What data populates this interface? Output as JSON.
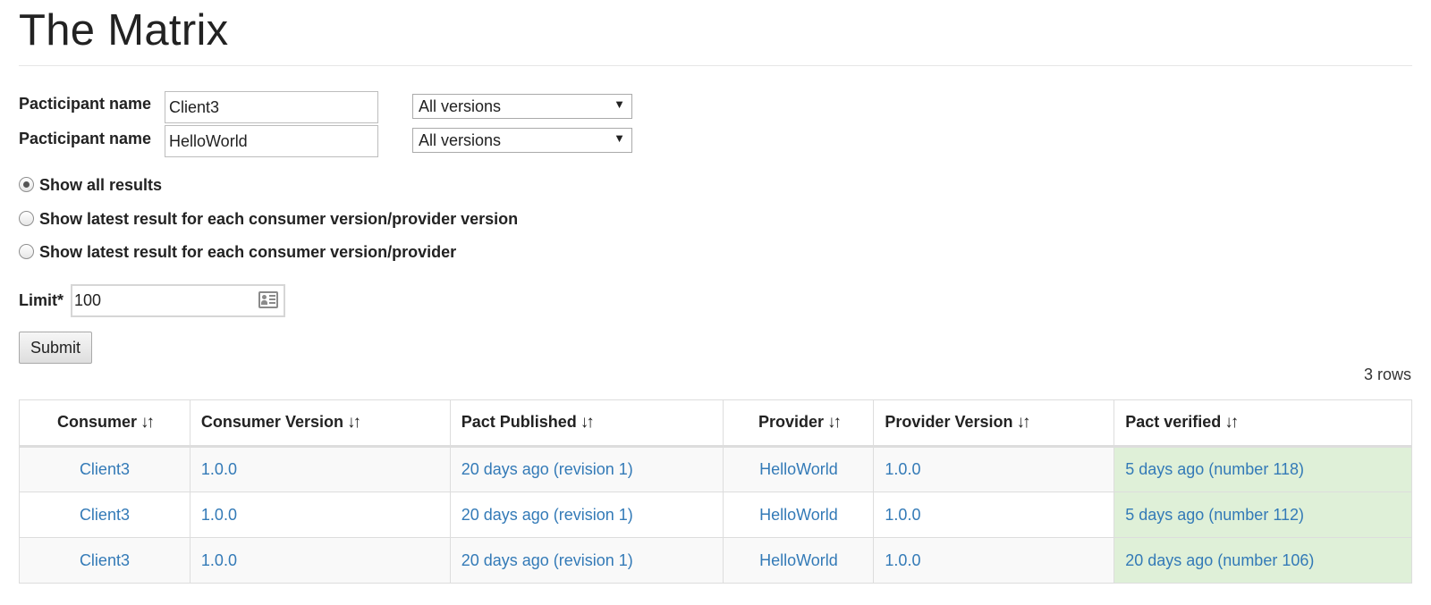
{
  "page": {
    "title": "The Matrix"
  },
  "form": {
    "participants": [
      {
        "label": "Pacticipant name",
        "name_value": "Client3",
        "version_selected": "All versions"
      },
      {
        "label": "Pacticipant name",
        "name_value": "HelloWorld",
        "version_selected": "All versions"
      }
    ],
    "radio_options": [
      {
        "label": "Show all results",
        "checked": true
      },
      {
        "label": "Show latest result for each consumer version/provider version",
        "checked": false
      },
      {
        "label": "Show latest result for each consumer version/provider",
        "checked": false
      }
    ],
    "limit_label": "Limit*",
    "limit_value": "100",
    "submit_label": "Submit"
  },
  "results": {
    "row_count_text": "3 rows",
    "sort_icon": "↓↑",
    "columns": [
      "Consumer",
      "Consumer Version",
      "Pact Published",
      "Provider",
      "Provider Version",
      "Pact verified"
    ],
    "rows": [
      {
        "consumer": "Client3",
        "consumer_version": "1.0.0",
        "pact_published": "20 days ago (revision 1)",
        "provider": "HelloWorld",
        "provider_version": "1.0.0",
        "pact_verified": "5 days ago (number 118)"
      },
      {
        "consumer": "Client3",
        "consumer_version": "1.0.0",
        "pact_published": "20 days ago (revision 1)",
        "provider": "HelloWorld",
        "provider_version": "1.0.0",
        "pact_verified": "5 days ago (number 112)"
      },
      {
        "consumer": "Client3",
        "consumer_version": "1.0.0",
        "pact_published": "20 days ago (revision 1)",
        "provider": "HelloWorld",
        "provider_version": "1.0.0",
        "pact_verified": "20 days ago (number 106)"
      }
    ]
  },
  "colors": {
    "link": "#337ab7",
    "verified_success": "#dff0d8",
    "stripe": "#f9f9f9"
  }
}
